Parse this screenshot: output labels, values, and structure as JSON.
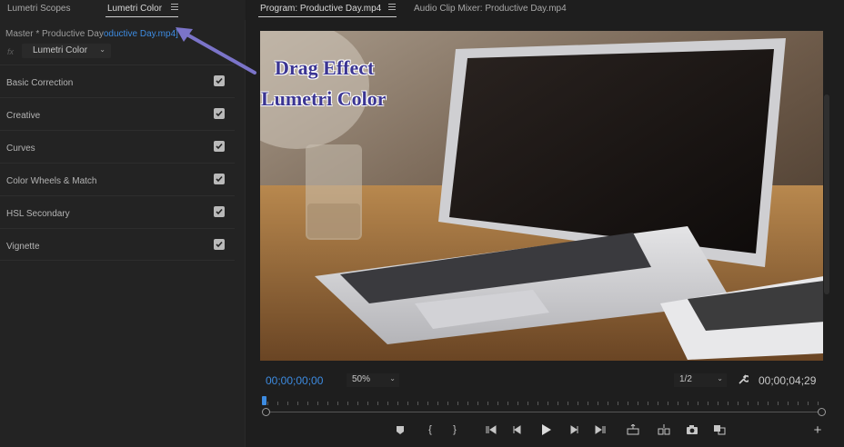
{
  "left_panel": {
    "tabs": [
      {
        "label": "Lumetri Scopes"
      },
      {
        "label": "Lumetri Color"
      }
    ],
    "master_prefix": "Master * Productive Day",
    "master_clip": "oductive Day.mp4",
    "master_suffix": "]",
    "fx": "fx",
    "effect_selected": "Lumetri Color",
    "sections": [
      {
        "label": "Basic Correction",
        "checked": true
      },
      {
        "label": "Creative",
        "checked": true
      },
      {
        "label": "Curves",
        "checked": true
      },
      {
        "label": "Color Wheels & Match",
        "checked": true
      },
      {
        "label": "HSL Secondary",
        "checked": true
      },
      {
        "label": "Vignette",
        "checked": true
      }
    ]
  },
  "program_monitor": {
    "tabs": [
      {
        "label": "Program: Productive Day.mp4"
      },
      {
        "label": "Audio Clip Mixer: Productive Day.mp4"
      }
    ],
    "timecode_current": "00;00;00;00",
    "timecode_duration": "00;00;04;29",
    "zoom": "50%",
    "resolution": "1/2",
    "playhead_fraction": 0.0,
    "controls": [
      "add-marker-icon",
      "mark-in-icon",
      "mark-out-icon",
      "go-to-in-icon",
      "step-back-icon",
      "play-icon",
      "step-forward-icon",
      "go-to-out-icon",
      "lift-icon",
      "extract-icon",
      "export-frame-icon",
      "compare-view-icon",
      "add-button-icon"
    ]
  },
  "annotation": {
    "line1": "Drag Effect",
    "line2": "Lumetri Color"
  },
  "colors": {
    "accent_blue": "#3d8be0",
    "annotation_text": "#3b3593",
    "annotation_arrow": "#7b74c9"
  }
}
